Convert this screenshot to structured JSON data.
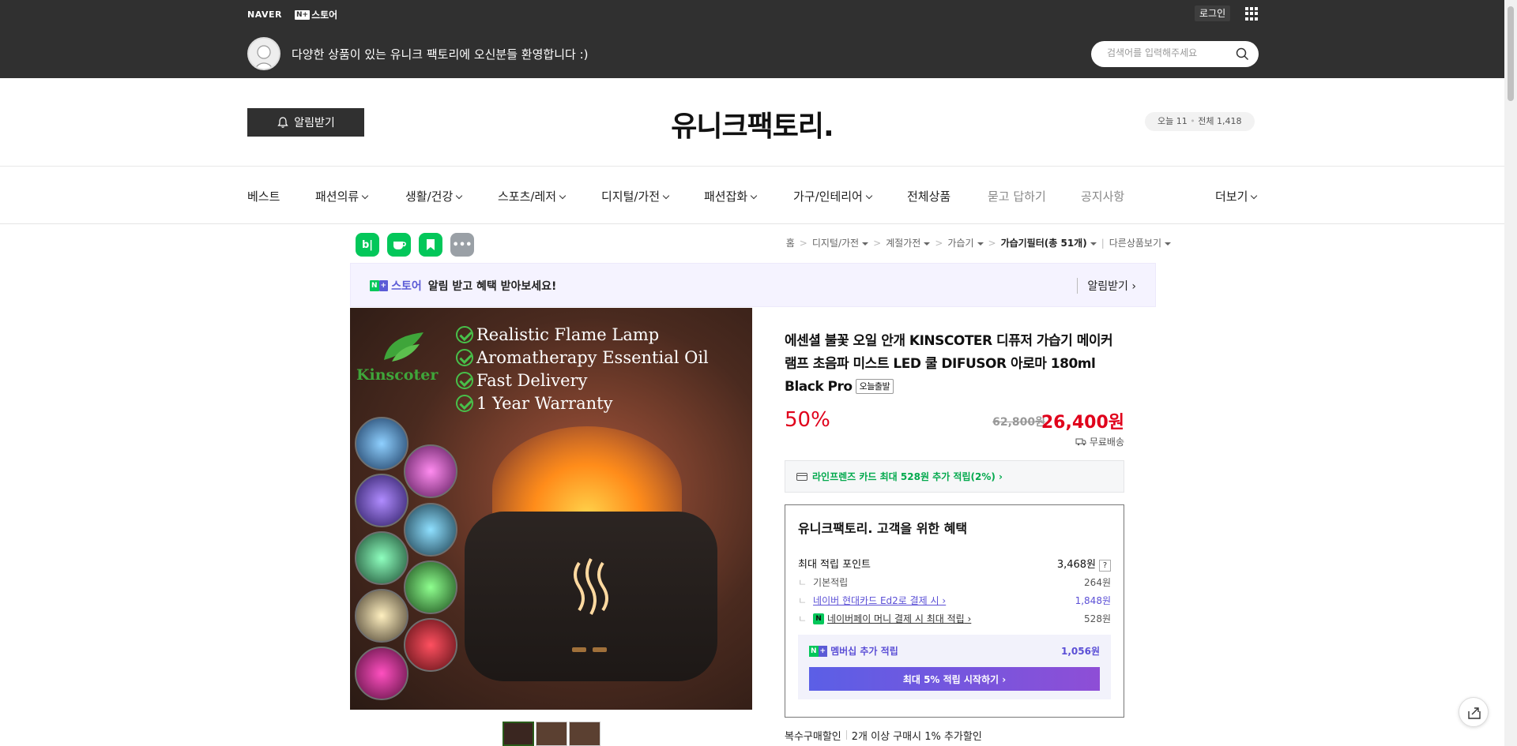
{
  "topbar": {
    "naver": "NAVER",
    "np_box": "N+",
    "store": "스토어",
    "login": "로그인",
    "welcome": "다양한 상품이 있는 유니크 팩토리에 오신분들 환영합니다 :)",
    "search_placeholder": "검색어를 입력해주세요"
  },
  "header": {
    "notify_label": "알림받기",
    "store_title": "유니크팩토리.",
    "today_label": "오늘",
    "today_count": "11",
    "total_label": "전체",
    "total_count": "1,418"
  },
  "gnb": {
    "items": [
      {
        "label": "베스트"
      },
      {
        "label": "패션의류"
      },
      {
        "label": "생활/건강"
      },
      {
        "label": "스포츠/레저"
      },
      {
        "label": "디지털/가전"
      },
      {
        "label": "패션잡화"
      },
      {
        "label": "가구/인테리어"
      },
      {
        "label": "전체상품"
      },
      {
        "label": "묻고 답하기"
      },
      {
        "label": "공지사항"
      },
      {
        "label": "더보기"
      }
    ]
  },
  "sns": {
    "blog": "b|",
    "more": "•••"
  },
  "breadcrumb": {
    "home": "홈",
    "c1": "디지털/가전",
    "c2": "계절가전",
    "c3": "가습기",
    "c4": "가습기필터(총 51개)",
    "other": "다른상품보기"
  },
  "banner": {
    "np_box": "N+",
    "store": "스토어",
    "text": "알림 받고 혜택 받아보세요!",
    "action": "알림받기"
  },
  "image": {
    "lines": [
      "Realistic Flame Lamp",
      "Aromatherapy Essential Oil",
      "Fast Delivery",
      "1 Year Warranty"
    ],
    "logo": "Kinscoter"
  },
  "product": {
    "title": "에센셜 불꽃 오일 안개 KINSCOTER 디퓨저 가습기 메이커 램프 초음파 미스트 LED 쿨 DIFUSOR 아로마 180ml Black Pro",
    "tag": "오늘출발",
    "discount": "50%",
    "original_price": "62,800원",
    "price": "26,400원",
    "shipping": "무료배송",
    "card_benefit": "라인프렌즈 카드 최대 528원 추가 적립(2%) ›"
  },
  "benefit": {
    "title": "유니크팩토리. 고객을 위한 혜택",
    "max_label": "최대 적립 포인트",
    "max_value": "3,468원",
    "q": "?",
    "basic_label": "기본적립",
    "basic_value": "264원",
    "card_label": "네이버 현대카드 Ed2로 결제 시",
    "card_value": "1,848원",
    "pay_label": "네이버페이 머니 결제 시 최대 적립",
    "pay_value": "528원",
    "npay_mark": "N",
    "member_label": "멤버십 추가 적립",
    "member_value": "1,056원",
    "member_btn": "최대 5% 적립 시작하기 ›"
  },
  "multi": {
    "label": "복수구매할인",
    "desc": "2개 이상 구매시 1% 추가할인"
  }
}
